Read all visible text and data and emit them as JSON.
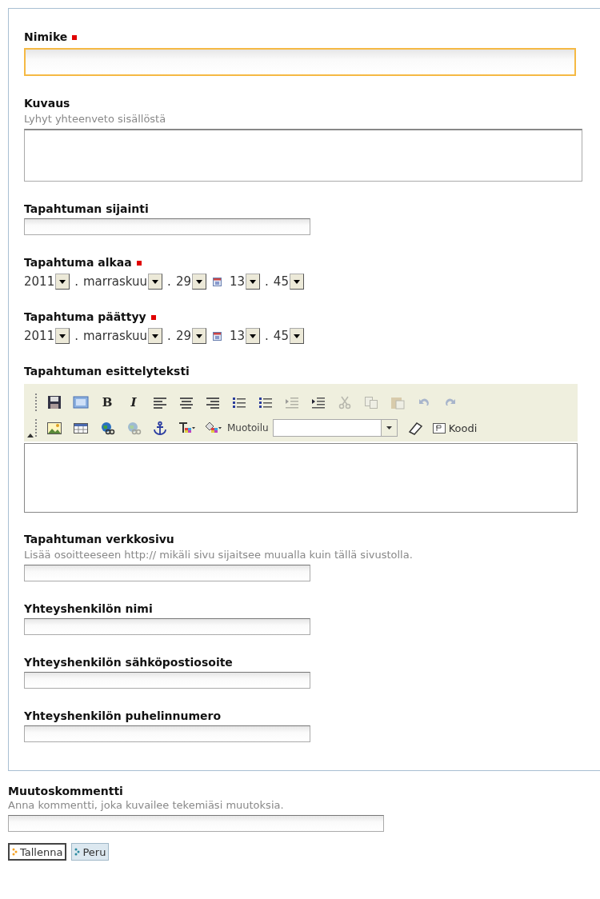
{
  "fields": [
    {
      "kind": "wide-input",
      "label": "Nimike",
      "required": true,
      "focused": true
    },
    {
      "kind": "textarea",
      "label": "Kuvaus",
      "required": false,
      "hint": "Lyhyt yhteenveto sisällöstä"
    },
    {
      "kind": "input",
      "label": "Tapahtuman sijainti",
      "required": false
    },
    {
      "kind": "datetime",
      "label": "Tapahtuma alkaa",
      "required": true,
      "year": "2011",
      "month": "marraskuu",
      "day": "29",
      "hour": "13",
      "minute": "45",
      "separator": "."
    },
    {
      "kind": "datetime",
      "label": "Tapahtuma päättyy",
      "required": true,
      "year": "2011",
      "month": "marraskuu",
      "day": "29",
      "hour": "13",
      "minute": "45",
      "separator": "."
    },
    {
      "kind": "editor",
      "label": "Tapahtuman esittelyteksti",
      "required": false,
      "toolbar": [
        [
          {
            "kind": "save",
            "disabled": false
          },
          {
            "kind": "preview",
            "disabled": false
          },
          {
            "kind": "bold",
            "label": "B",
            "disabled": false
          },
          {
            "kind": "italic",
            "label": "I",
            "disabled": false
          },
          {
            "kind": "align-left",
            "disabled": false
          },
          {
            "kind": "align-center",
            "disabled": false
          },
          {
            "kind": "align-right",
            "disabled": false
          },
          {
            "kind": "ordered-list",
            "disabled": false
          },
          {
            "kind": "bullet-list",
            "disabled": false
          },
          {
            "kind": "outdent",
            "disabled": true
          },
          {
            "kind": "indent",
            "disabled": false
          },
          {
            "kind": "cut",
            "disabled": true
          },
          {
            "kind": "copy",
            "disabled": true
          },
          {
            "kind": "paste",
            "disabled": true
          },
          {
            "kind": "undo",
            "disabled": true
          },
          {
            "kind": "redo",
            "disabled": true
          }
        ],
        [
          {
            "kind": "image",
            "disabled": false
          },
          {
            "kind": "table",
            "disabled": false
          },
          {
            "kind": "link",
            "disabled": false
          },
          {
            "kind": "unlink",
            "disabled": true
          },
          {
            "kind": "anchor",
            "disabled": false
          },
          {
            "kind": "text-color",
            "disabled": false
          },
          {
            "kind": "background-color",
            "disabled": false
          },
          {
            "kind": "format",
            "label": "Muotoilu"
          },
          {
            "kind": "eraser",
            "disabled": false
          },
          {
            "kind": "code",
            "label": "Koodi",
            "disabled": false
          }
        ]
      ]
    },
    {
      "kind": "input",
      "label": "Tapahtuman verkkosivu",
      "required": false,
      "hint": "Lisää osoitteeseen http:// mikäli sivu sijaitsee muualla kuin tällä sivustolla."
    },
    {
      "kind": "input",
      "label": "Yhteyshenkilön nimi",
      "required": false
    },
    {
      "kind": "input",
      "label": "Yhteyshenkilön sähköpostiosoite",
      "required": false
    },
    {
      "kind": "input",
      "label": "Yhteyshenkilön puhelinnumero",
      "required": false
    }
  ],
  "comment": {
    "label": "Muutoskommentti",
    "hint": "Anna kommentti, joka kuvailee tekemiäsi muutoksia."
  },
  "buttons": [
    {
      "label": "Tallenna",
      "kind": "primary"
    },
    {
      "label": "Peru",
      "kind": "secondary"
    }
  ]
}
